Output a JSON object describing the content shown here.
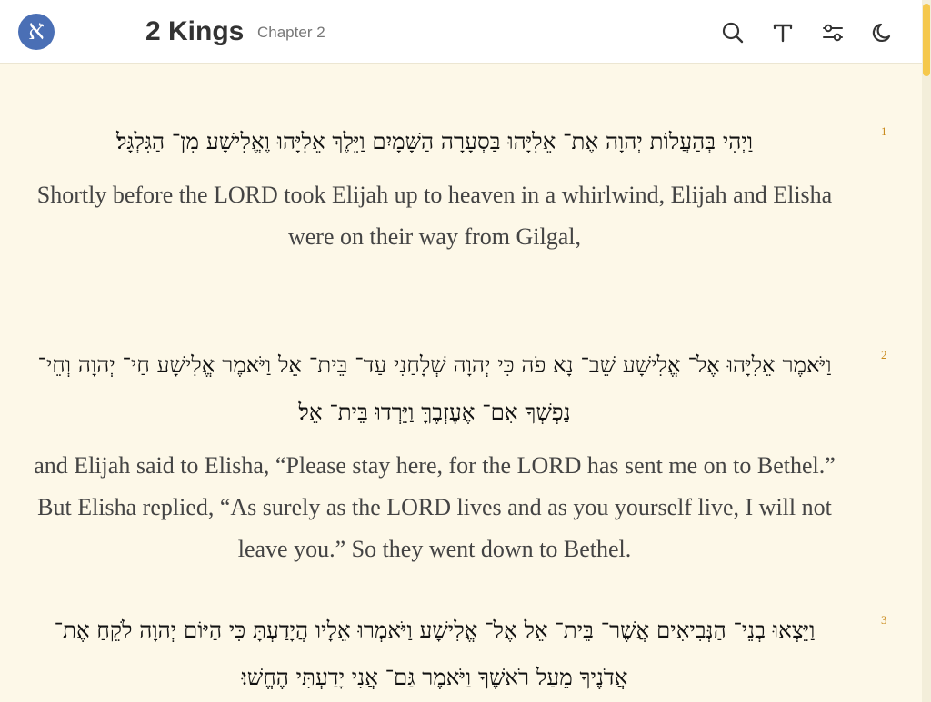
{
  "header": {
    "logo_glyph": "א",
    "book_title": "2 Kings",
    "chapter_label": "Chapter 2"
  },
  "toolbar": {
    "icons": [
      "search-icon",
      "text-size-icon",
      "settings-sliders-icon",
      "dark-mode-moon-icon"
    ]
  },
  "colors": {
    "logo_bg": "#4a6fb5",
    "verse_number": "#c98a1b",
    "page_bg": "#fdf8e8",
    "scroll_thumb": "#f5c84c"
  },
  "verses": [
    {
      "number": "1",
      "hebrew": "וַיְהִי בְּהַעֲלוֹת יְהוָה אֶת־ אֵלִיָּהוּ בַּסְעָרָה הַשָּׁמָיִם וַיֵּלֶךְ אֵלִיָּהוּ וֶאֱלִישָׁע מִן־ הַגִּלְגָּל׃",
      "english": "Shortly before the LORD took Elijah up to heaven in a whirlwind, Elijah and Elisha were on their way from Gilgal,"
    },
    {
      "number": "2",
      "hebrew": "וַיֹּאמֶר אֵלִיָּהוּ אֶל־ אֱלִישָׁע שֵׁב־ נָא פֹה כִּי יְהוָה שְׁלָחַנִי עַד־ בֵּית־ אֵל וַיֹּאמֶר אֱלִישָׁע חַי־ יְהוָה וְחֵי־ נַפְשְׁךָ אִם־ אֶעֶזְבֶךָּ וַיֵּרְדוּ בֵּית־ אֵל׃",
      "english": "and Elijah said to Elisha, “Please stay here, for the LORD has sent me on to Bethel.” But Elisha replied, “As surely as the LORD lives and as you yourself live, I will not leave you.” So they went down to Bethel."
    },
    {
      "number": "3",
      "hebrew": "וַיֵּצְאוּ בְנֵי־ הַנְּבִיאִים אֲשֶׁר־ בֵּית־ אֵל אֶל־ אֱלִישָׁע וַיֹּאמְרוּ אֵלָיו הֲיָדַעְתָּ כִּי הַיּוֹם יְהוָה לֹקֵחַ אֶת־ אֲדֹנֶיךָ מֵעַל רֹאשֶׁךָ וַיֹּאמֶר גַּם־ אֲנִי יָדַעְתִּי הֶחֱשׁוּ׃",
      "english": ""
    }
  ]
}
